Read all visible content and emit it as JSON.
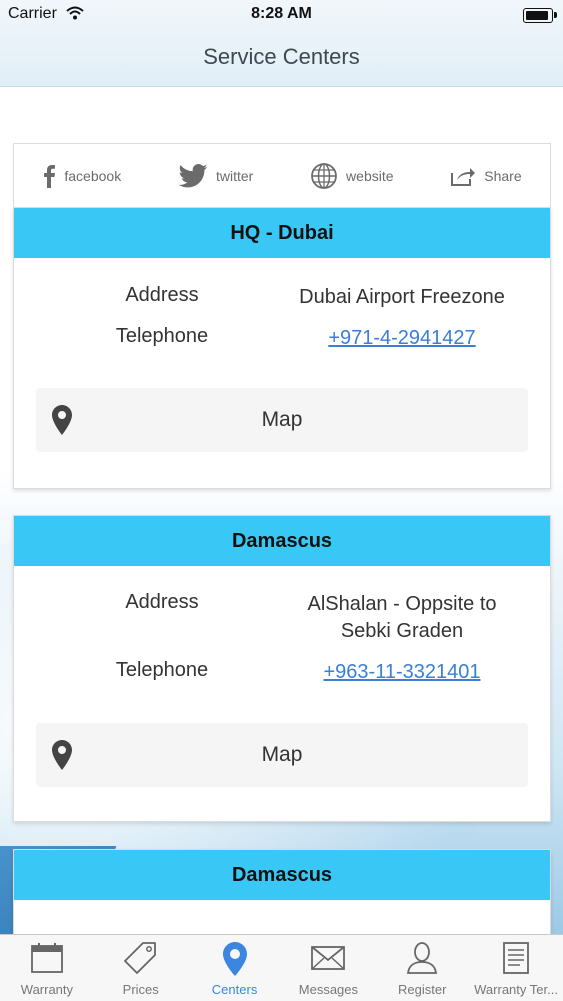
{
  "status_bar": {
    "carrier": "Carrier",
    "time": "8:28 AM"
  },
  "header": {
    "title": "Service Centers"
  },
  "social": [
    {
      "label": "facebook",
      "icon": "facebook-icon"
    },
    {
      "label": "twitter",
      "icon": "twitter-icon"
    },
    {
      "label": "website",
      "icon": "globe-icon"
    },
    {
      "label": "Share",
      "icon": "share-icon"
    }
  ],
  "centers": [
    {
      "name": "HQ - Dubai",
      "address_label": "Address",
      "address": "Dubai Airport Freezone",
      "telephone_label": "Telephone",
      "telephone": "+971-4-2941427",
      "map_label": "Map"
    },
    {
      "name": "Damascus",
      "address_label": "Address",
      "address_line1": "AlShalan - Oppsite to",
      "address_line2": "Sebki Graden",
      "telephone_label": "Telephone",
      "telephone": "+963-11-3321401",
      "map_label": "Map"
    },
    {
      "name": "Damascus"
    }
  ],
  "tabs": [
    {
      "label": "Warranty",
      "icon": "calendar-icon"
    },
    {
      "label": "Prices",
      "icon": "price-tag-icon"
    },
    {
      "label": "Centers",
      "icon": "location-pin-icon",
      "active": true
    },
    {
      "label": "Messages",
      "icon": "envelope-icon"
    },
    {
      "label": "Register",
      "icon": "person-icon"
    },
    {
      "label": "Warranty Ter...",
      "icon": "document-icon"
    }
  ],
  "colors": {
    "card_header": "#39c8f6",
    "link": "#3a7fd5",
    "active_tab": "#3a86e0"
  }
}
